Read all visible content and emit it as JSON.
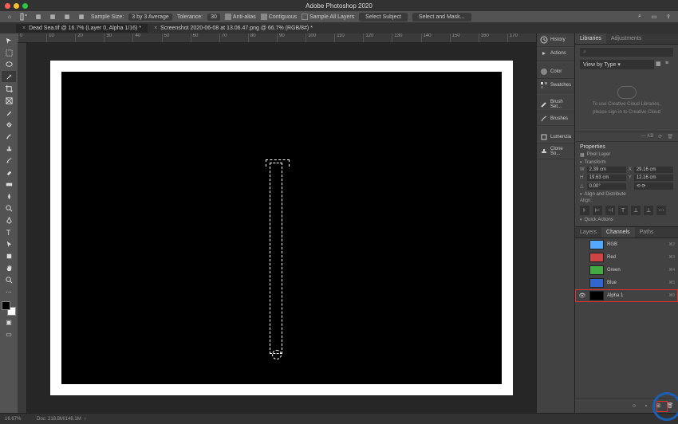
{
  "app": {
    "title": "Adobe Photoshop 2020"
  },
  "options": {
    "sample_size_label": "Sample Size:",
    "sample_size_value": "3 by 3 Average",
    "tolerance_label": "Tolerance:",
    "tolerance_value": "30",
    "antialias_label": "Anti-alias",
    "contiguous_label": "Contiguous",
    "sample_all_label": "Sample All Layers",
    "select_subject": "Select Subject",
    "select_and_mask": "Select and Mask..."
  },
  "tabs": [
    {
      "label": "Dead Sea.tif @ 16.7% (Layer 0, Alpha 1/16) *",
      "active": true
    },
    {
      "label": "Screenshot 2020-06-08 at 13.06.47.png @ 66.7% (RGB/8#) *",
      "active": false
    }
  ],
  "collapsed_panels": [
    {
      "icon": "history",
      "label": "History"
    },
    {
      "icon": "actions",
      "label": "Actions"
    },
    {
      "icon": "color",
      "label": "Color"
    },
    {
      "icon": "swatches",
      "label": "Swatches"
    },
    {
      "icon": "brush-set",
      "label": "Brush Set..."
    },
    {
      "icon": "brushes",
      "label": "Brushes"
    },
    {
      "icon": "lumenzia",
      "label": "Lumenzia"
    },
    {
      "icon": "clone",
      "label": "Clone So..."
    }
  ],
  "libraries": {
    "tab1": "Libraries",
    "tab2": "Adjustments",
    "view_label": "View by Type",
    "empty_line1": "To use Creative Cloud Libraries,",
    "empty_line2": "please sign in to Creative Cloud",
    "kb": "— KB"
  },
  "properties": {
    "title": "Properties",
    "type_label": "Pixel Layer",
    "transform_label": "Transform",
    "w_label": "W",
    "w_val": "2.39 cm",
    "x_label": "X",
    "x_val": "29.16 cm",
    "h_label": "H",
    "h_val": "19.63 cm",
    "y_label": "Y",
    "y_val": "12.16 cm",
    "angle_val": "0.00°",
    "flip_val": "⟲ ⟳",
    "align_label": "Align and Distribute",
    "align_sub": "Align:",
    "quick_label": "Quick Actions"
  },
  "channels": {
    "tab_layers": "Layers",
    "tab_channels": "Channels",
    "tab_paths": "Paths",
    "rows": [
      {
        "name": "RGB",
        "key": "⌘2",
        "thumb": "rgb",
        "vis": false
      },
      {
        "name": "Red",
        "key": "⌘3",
        "thumb": "red",
        "vis": false
      },
      {
        "name": "Green",
        "key": "⌘4",
        "thumb": "green",
        "vis": false
      },
      {
        "name": "Blue",
        "key": "⌘5",
        "thumb": "blue",
        "vis": false
      },
      {
        "name": "Alpha 1",
        "key": "⌘6",
        "thumb": "alpha",
        "vis": true,
        "hl": true
      }
    ]
  },
  "status": {
    "zoom": "16.67%",
    "doc": "Doc: 218.8M/148.1M"
  }
}
